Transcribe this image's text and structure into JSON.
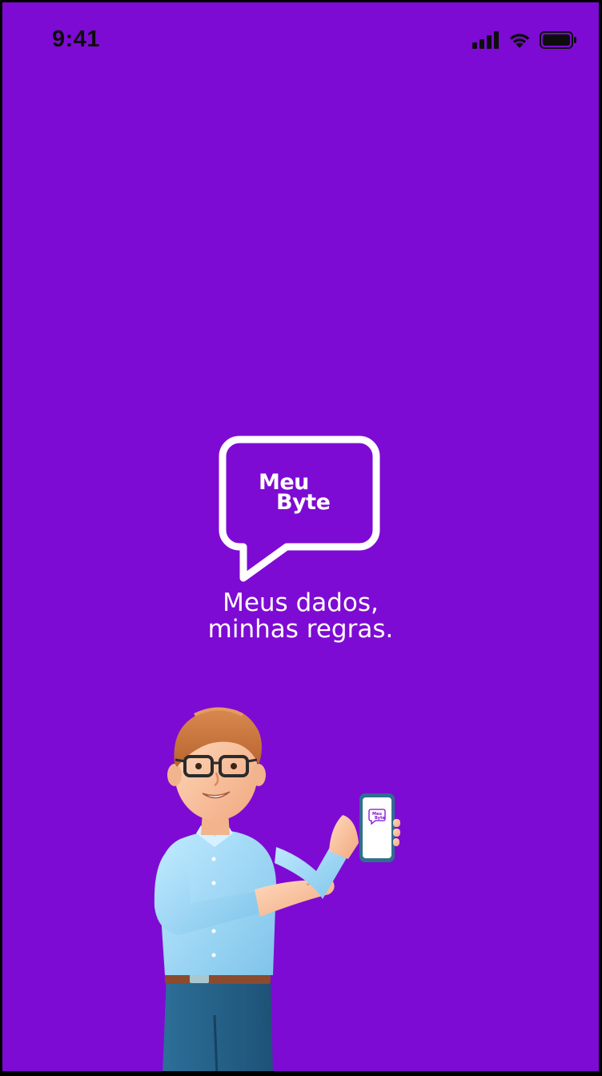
{
  "status_bar": {
    "time": "9:41",
    "icons": [
      "cellular-signal-icon",
      "wifi-icon",
      "battery-icon"
    ]
  },
  "brand": {
    "logo_line1": "Meu",
    "logo_line2": "Byte",
    "tagline_line1": "Meus dados,",
    "tagline_line2": "minhas regras."
  },
  "colors": {
    "background": "#7e0bd3",
    "logo": "#ffffff",
    "text": "#ffffff"
  },
  "illustration": {
    "subject": "man-holding-phone-illustration"
  }
}
